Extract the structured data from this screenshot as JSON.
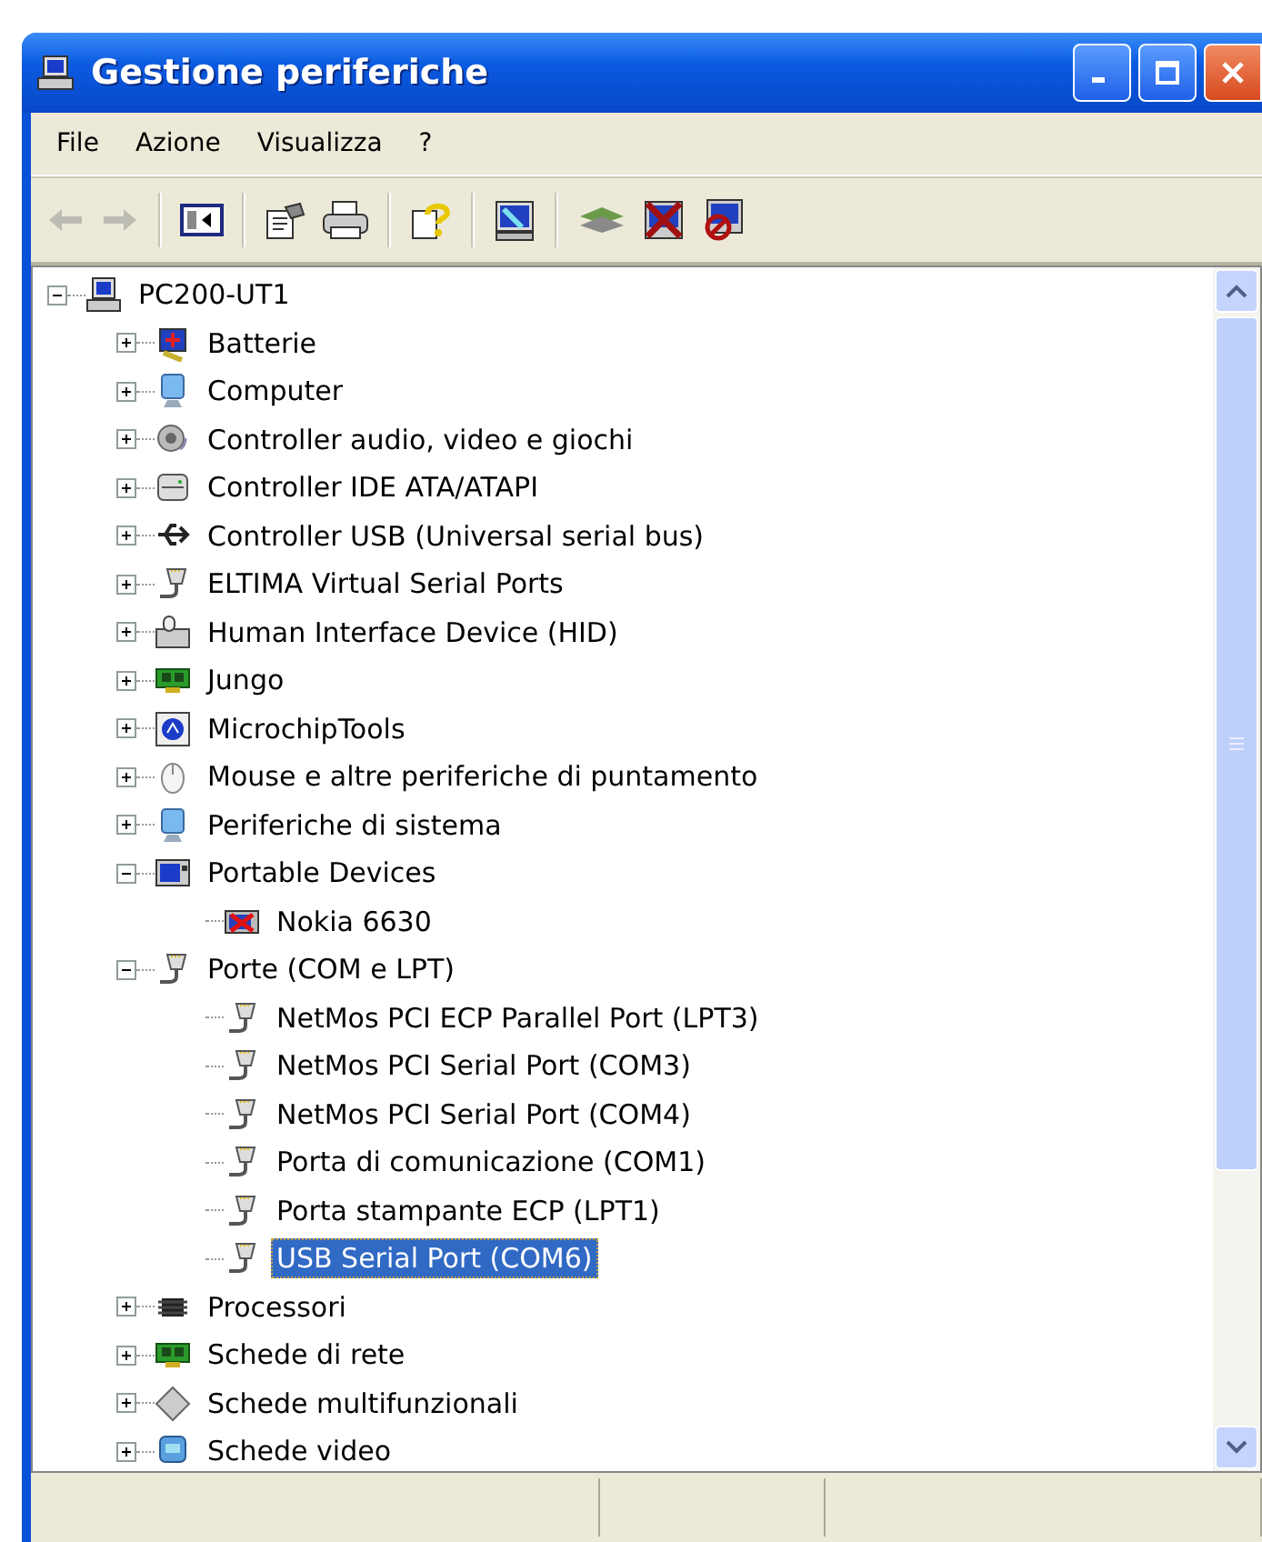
{
  "window": {
    "title": "Gestione periferiche"
  },
  "menu": [
    {
      "label": "File"
    },
    {
      "label": "Azione"
    },
    {
      "label": "Visualizza"
    },
    {
      "label": "?"
    }
  ],
  "toolbar": [
    {
      "kind": "back",
      "disabled": true
    },
    {
      "kind": "forward",
      "disabled": true
    },
    {
      "kind": "separator"
    },
    {
      "kind": "panel"
    },
    {
      "kind": "separator"
    },
    {
      "kind": "properties",
      "disabled": false
    },
    {
      "kind": "print",
      "disabled": false
    },
    {
      "kind": "separator"
    },
    {
      "kind": "help",
      "disabled": false
    },
    {
      "kind": "separator"
    },
    {
      "kind": "scan",
      "disabled": false
    },
    {
      "kind": "separator"
    },
    {
      "kind": "update",
      "disabled": false
    },
    {
      "kind": "uninstall",
      "disabled": false
    },
    {
      "kind": "disable",
      "disabled": false
    }
  ],
  "tree": [
    {
      "label": "PC200-UT1",
      "kind": "computer",
      "expanded": true,
      "selected": false,
      "children": [
        {
          "label": "Batterie",
          "kind": "battery",
          "expanded": false,
          "selected": false
        },
        {
          "label": "Computer",
          "kind": "monitor",
          "expanded": false,
          "selected": false
        },
        {
          "label": "Controller audio, video e giochi",
          "kind": "speaker",
          "expanded": false,
          "selected": false
        },
        {
          "label": "Controller IDE ATA/ATAPI",
          "kind": "drive",
          "expanded": false,
          "selected": false
        },
        {
          "label": "Controller USB (Universal serial bus)",
          "kind": "usb",
          "expanded": false,
          "selected": false
        },
        {
          "label": "ELTIMA Virtual Serial Ports",
          "kind": "port",
          "expanded": false,
          "selected": false
        },
        {
          "label": "Human Interface Device (HID)",
          "kind": "keyboard",
          "expanded": false,
          "selected": false
        },
        {
          "label": "Jungo",
          "kind": "board",
          "expanded": false,
          "selected": false
        },
        {
          "label": "MicrochipTools",
          "kind": "chiptool",
          "expanded": false,
          "selected": false
        },
        {
          "label": "Mouse e altre periferiche di puntamento",
          "kind": "mouse",
          "expanded": false,
          "selected": false
        },
        {
          "label": "Periferiche di sistema",
          "kind": "monitor",
          "expanded": false,
          "selected": false
        },
        {
          "label": "Portable Devices",
          "kind": "portable",
          "expanded": true,
          "selected": false,
          "children": [
            {
              "label": "Nokia 6630",
              "kind": "phone",
              "selected": false
            }
          ]
        },
        {
          "label": "Porte (COM e LPT)",
          "kind": "port",
          "expanded": true,
          "selected": false,
          "children": [
            {
              "label": "NetMos PCI ECP Parallel Port (LPT3)",
              "kind": "port",
              "selected": false
            },
            {
              "label": "NetMos PCI Serial Port (COM3)",
              "kind": "port",
              "selected": false
            },
            {
              "label": "NetMos PCI Serial Port (COM4)",
              "kind": "port",
              "selected": false
            },
            {
              "label": "Porta di comunicazione (COM1)",
              "kind": "port",
              "selected": false
            },
            {
              "label": "Porta stampante ECP (LPT1)",
              "kind": "port",
              "selected": false
            },
            {
              "label": "USB Serial Port (COM6)",
              "kind": "port",
              "selected": true
            }
          ]
        },
        {
          "label": "Processori",
          "kind": "chip",
          "expanded": false,
          "selected": false
        },
        {
          "label": "Schede di rete",
          "kind": "board",
          "expanded": false,
          "selected": false
        },
        {
          "label": "Schede multifunzionali",
          "kind": "diamond",
          "expanded": false,
          "selected": false
        },
        {
          "label": "Schede video",
          "kind": "display",
          "expanded": false,
          "selected": false
        }
      ]
    }
  ]
}
